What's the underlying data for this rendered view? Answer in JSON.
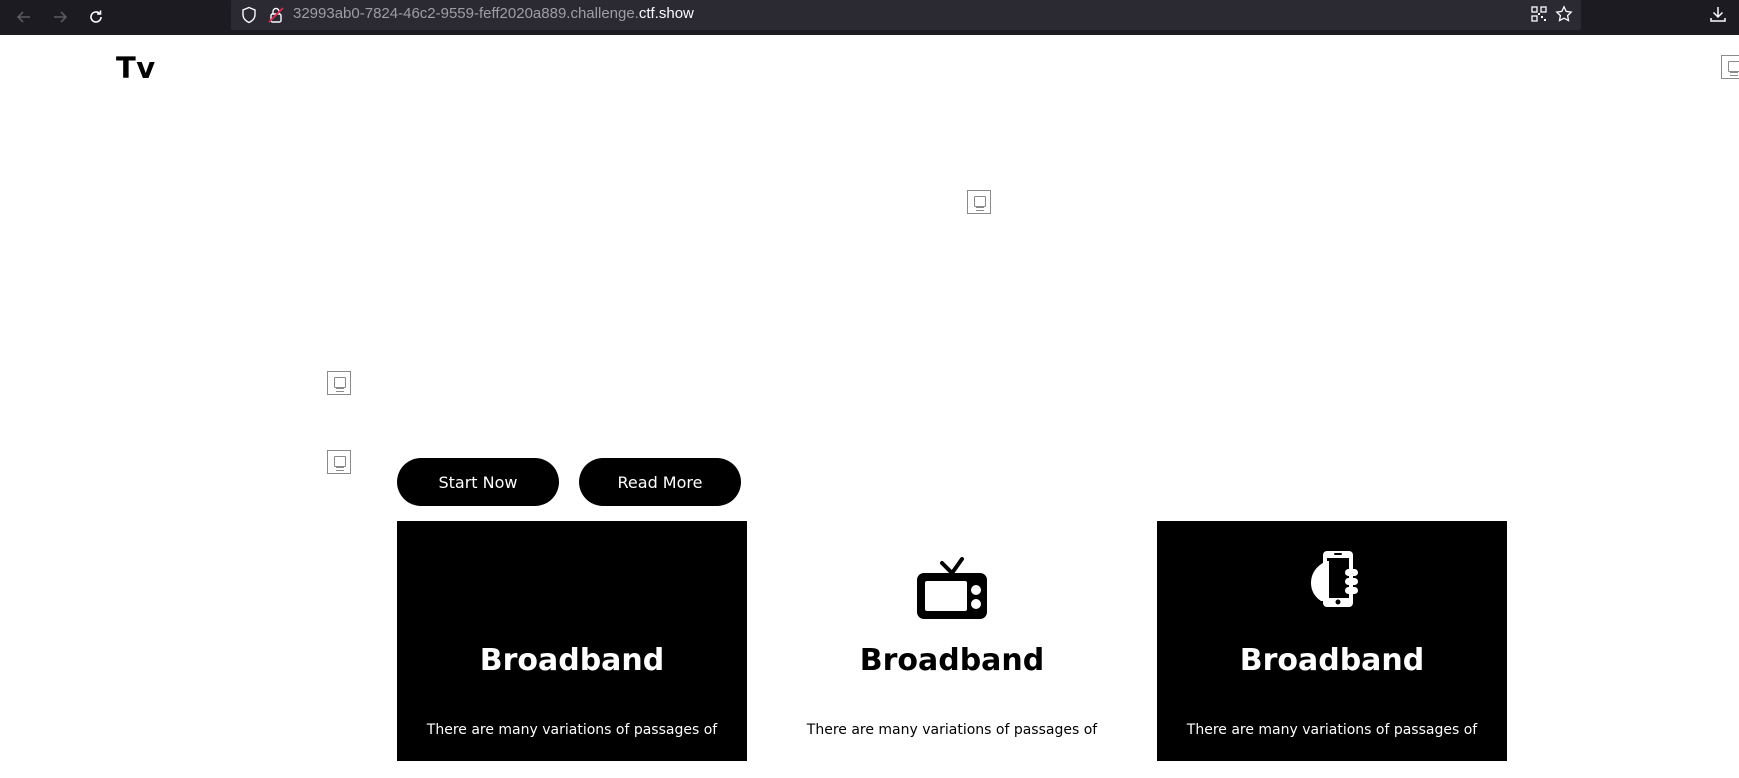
{
  "browser": {
    "url_prefix": "32993ab0-7824-46c2-9559-feff2020a889.challenge.",
    "url_domain": "ctf.show",
    "icons": [
      "back-arrow-icon",
      "forward-arrow-icon",
      "reload-icon",
      "shield-icon",
      "insecure-lock-icon",
      "qr-code-icon",
      "bookmark-star-icon",
      "download-icon"
    ]
  },
  "header": {
    "logo": "Tv"
  },
  "hero": {
    "start_label": "Start Now",
    "read_more_label": "Read More"
  },
  "cards": [
    {
      "title": "Broadband",
      "text": "There are many variations of passages of",
      "icon": "none",
      "theme": "dark"
    },
    {
      "title": "Broadband",
      "text": "There are many variations of passages of",
      "icon": "tv-icon",
      "theme": "light"
    },
    {
      "title": "Broadband",
      "text": "There are many variations of passages of",
      "icon": "phone-in-hand-icon",
      "theme": "dark"
    }
  ],
  "colors": {
    "chrome_bg": "#1c1b22",
    "urlbar_bg": "#2b2a33",
    "accent": "#000000",
    "page_bg": "#ffffff"
  }
}
